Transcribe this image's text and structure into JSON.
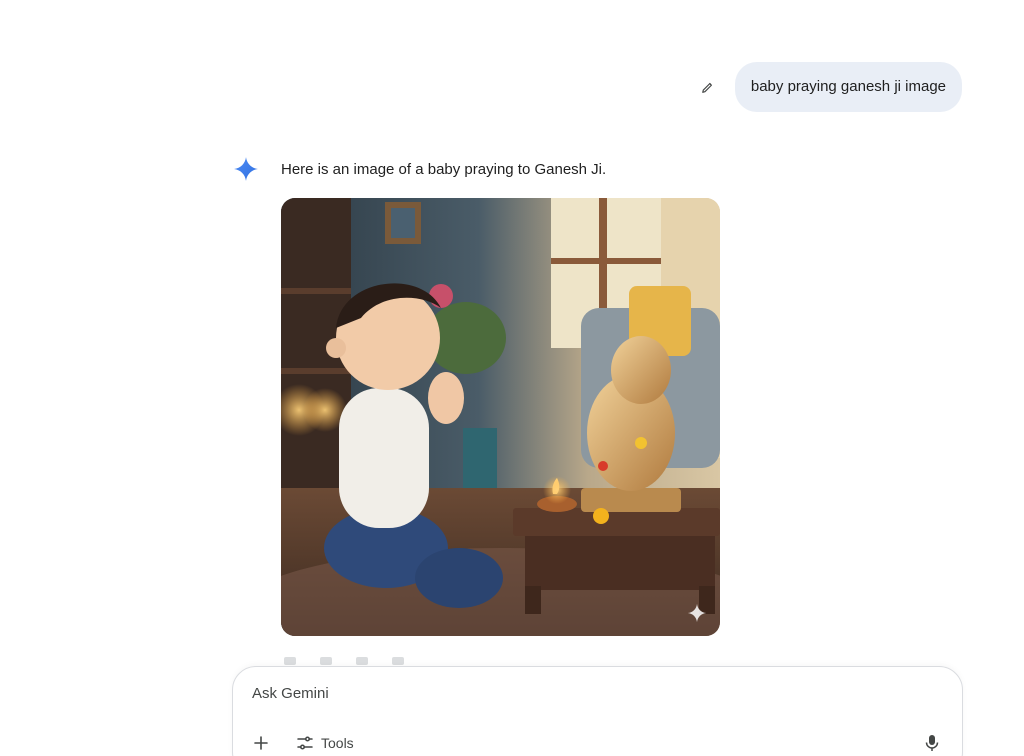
{
  "conversation": {
    "user_prompt": "baby praying ganesh ji image",
    "response_text": "Here is an image of a baby praying to Ganesh Ji."
  },
  "image": {
    "subject": "generated-image-baby-praying-ganesh"
  },
  "input": {
    "placeholder": "Ask Gemini",
    "tools_label": "Tools"
  },
  "icons": {
    "edit": "pencil-icon",
    "gemini": "gemini-sparkle-icon",
    "plus": "plus-icon",
    "tools": "tools-sliders-icon",
    "mic": "microphone-icon",
    "watermark": "sparkle-watermark-icon"
  },
  "colors": {
    "user_bubble_bg": "#e9eef6",
    "gemini_blue": "#4285f4",
    "text": "#1f1f1f",
    "muted": "#444746"
  }
}
